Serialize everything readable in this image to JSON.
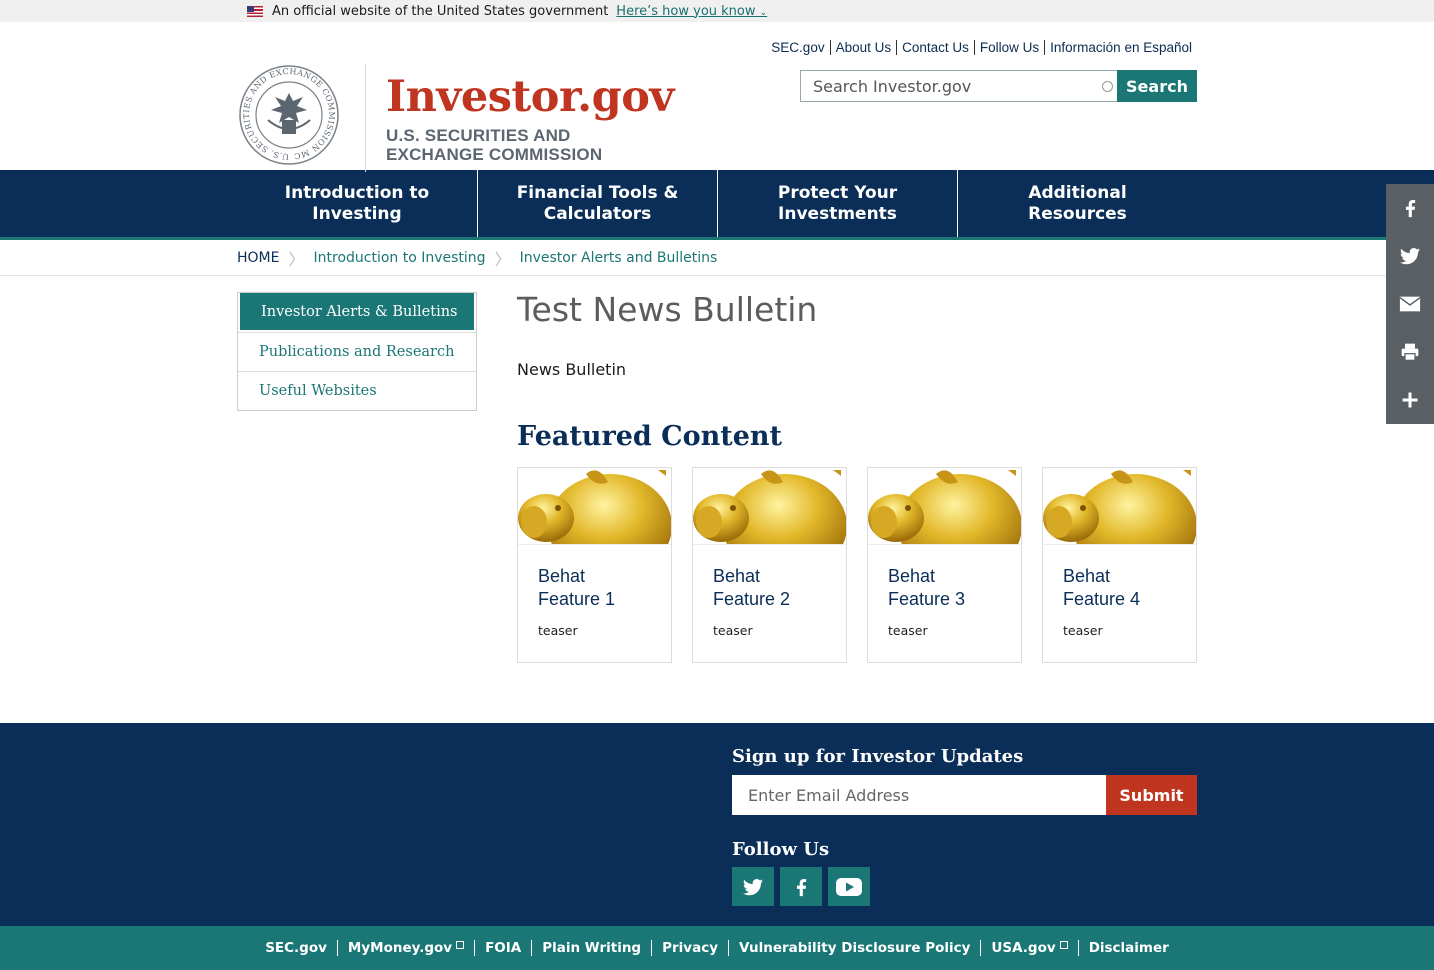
{
  "gov_banner": {
    "text": "An official website of the United States government",
    "link": "Here’s how you know"
  },
  "logo": {
    "title": "Investor.gov",
    "subtitle_1": "U.S. SECURITIES AND",
    "subtitle_2": "EXCHANGE COMMISSION",
    "seal_text": "U.S. SECURITIES AND EXCHANGE COMMISSION MCMXXXIV"
  },
  "utility_links": [
    "SEC.gov",
    "About Us",
    "Contact Us",
    "Follow Us",
    "Información en Español"
  ],
  "search": {
    "placeholder": "Search Investor.gov",
    "button": "Search"
  },
  "nav": [
    {
      "line1": "Introduction to",
      "line2": "Investing"
    },
    {
      "line1": "Financial Tools &",
      "line2": "Calculators"
    },
    {
      "line1": "Protect Your",
      "line2": "Investments"
    },
    {
      "line1": "Additional",
      "line2": "Resources"
    }
  ],
  "breadcrumb": [
    "HOME",
    "Introduction to Investing",
    "Investor Alerts and Bulletins"
  ],
  "sidebar": [
    "Investor Alerts & Bulletins",
    "Publications and Research",
    "Useful Websites"
  ],
  "main": {
    "title": "Test News Bulletin",
    "subtitle": "News Bulletin",
    "featured_heading": "Featured Content"
  },
  "cards": [
    {
      "line1": "Behat",
      "line2": "Feature 1",
      "teaser": "teaser"
    },
    {
      "line1": "Behat",
      "line2": "Feature 2",
      "teaser": "teaser"
    },
    {
      "line1": "Behat",
      "line2": "Feature 3",
      "teaser": "teaser"
    },
    {
      "line1": "Behat",
      "line2": "Feature 4",
      "teaser": "teaser"
    }
  ],
  "share_icons": [
    "facebook-icon",
    "twitter-icon",
    "email-icon",
    "print-icon",
    "plus-icon"
  ],
  "footer": {
    "signup_title": "Sign up for Investor Updates",
    "email_placeholder": "Enter Email Address",
    "submit": "Submit",
    "follow_title": "Follow Us",
    "social_icons": [
      "twitter-icon",
      "facebook-icon",
      "youtube-icon"
    ],
    "links": [
      "SEC.gov",
      "MyMoney.gov",
      "FOIA",
      "Plain Writing",
      "Privacy",
      "Vulnerability Disclosure Policy",
      "USA.gov",
      "Disclaimer"
    ]
  },
  "colors": {
    "navy": "#0a2e57",
    "teal": "#1b7676",
    "red": "#c0351f",
    "share_gray": "#5a5f64"
  }
}
